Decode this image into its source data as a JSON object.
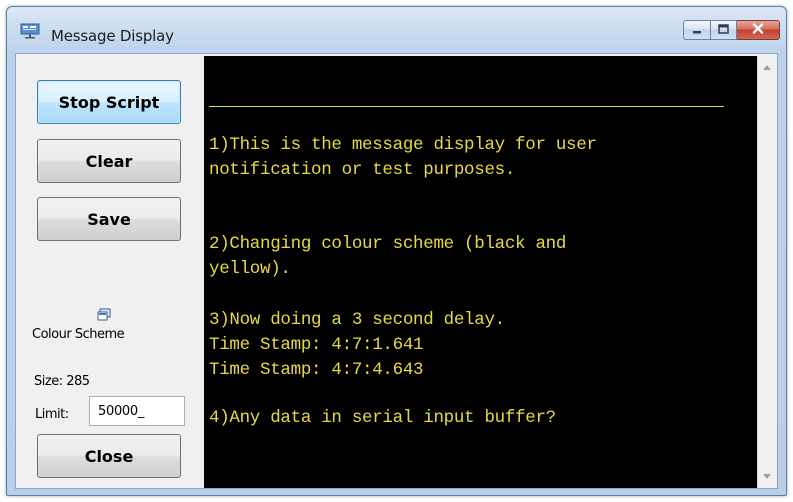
{
  "window": {
    "title": "Message Display",
    "icon": "display-window-icon"
  },
  "caption": {
    "minimize_icon": "minimize-icon",
    "maximize_icon": "maximize-icon",
    "close_icon": "close-icon"
  },
  "sidebar": {
    "stop_script_label": "Stop Script",
    "clear_label": "Clear",
    "save_label": "Save",
    "colour_scheme_icon": "colour-scheme-icon",
    "colour_scheme_label": "Colour Scheme",
    "size_label": "Size: 285",
    "limit_label": "Limit:",
    "limit_value": "50000_",
    "close_label": "Close"
  },
  "console": {
    "background_color": "#000000",
    "text_color": "#e8d840",
    "lines": [
      "1)This is the message display for user",
      "notification or test purposes.",
      "2)Changing colour scheme (black and",
      "yellow).",
      "3)Now doing a 3 second delay.",
      "Time Stamp: 4:7:1.641",
      "Time Stamp: 4:7:4.643",
      "4)Any data in serial input buffer?"
    ]
  }
}
